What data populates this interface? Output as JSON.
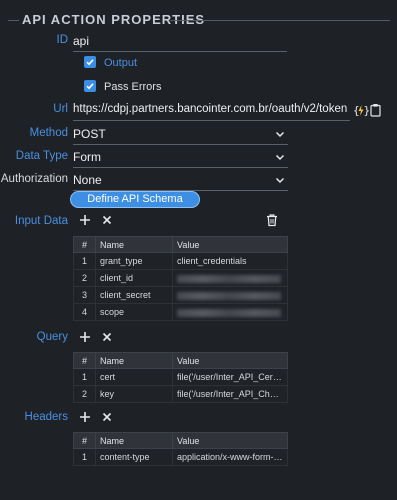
{
  "section": {
    "title": "API ACTION PROPERTIES"
  },
  "fields": {
    "id": {
      "label": "ID",
      "value": "api"
    },
    "output": {
      "label": "Output",
      "checked": true
    },
    "pass_errors": {
      "label": "Pass Errors",
      "checked": true
    },
    "url": {
      "label": "Url",
      "value": "https://cdpj.partners.bancointer.com.br/oauth/v2/token"
    },
    "method": {
      "label": "Method",
      "value": "POST"
    },
    "data_type": {
      "label": "Data Type",
      "value": "Form"
    },
    "authorization": {
      "label": "Authorization",
      "value": "None"
    }
  },
  "define_schema_button": "Define API Schema",
  "input_data": {
    "label": "Input Data",
    "columns": [
      "#",
      "Name",
      "Value"
    ],
    "rows": [
      {
        "num": "1",
        "name": "grant_type",
        "value": "client_credentials"
      },
      {
        "num": "2",
        "name": "client_id",
        "value": ""
      },
      {
        "num": "3",
        "name": "client_secret",
        "value": ""
      },
      {
        "num": "4",
        "name": "scope",
        "value": ""
      }
    ]
  },
  "query": {
    "label": "Query",
    "columns": [
      "#",
      "Name",
      "Value"
    ],
    "rows": [
      {
        "num": "1",
        "name": "cert",
        "value": "file('/user/Inter_API_Certific..."
      },
      {
        "num": "2",
        "name": "key",
        "value": "file('/user/Inter_API_Chave...."
      }
    ]
  },
  "headers": {
    "label": "Headers",
    "columns": [
      "#",
      "Name",
      "Value"
    ],
    "rows": [
      {
        "num": "1",
        "name": "content-type",
        "value": "application/x-www-form-urle..."
      }
    ]
  },
  "colors": {
    "accent": "#4a90e2",
    "button": "#3d8fe3",
    "background": "#1e2125"
  },
  "icons": [
    "lightning-braces-icon",
    "clipboard-icon",
    "chevron-down-icon",
    "plus-icon",
    "close-icon",
    "trash-icon",
    "check-icon"
  ]
}
